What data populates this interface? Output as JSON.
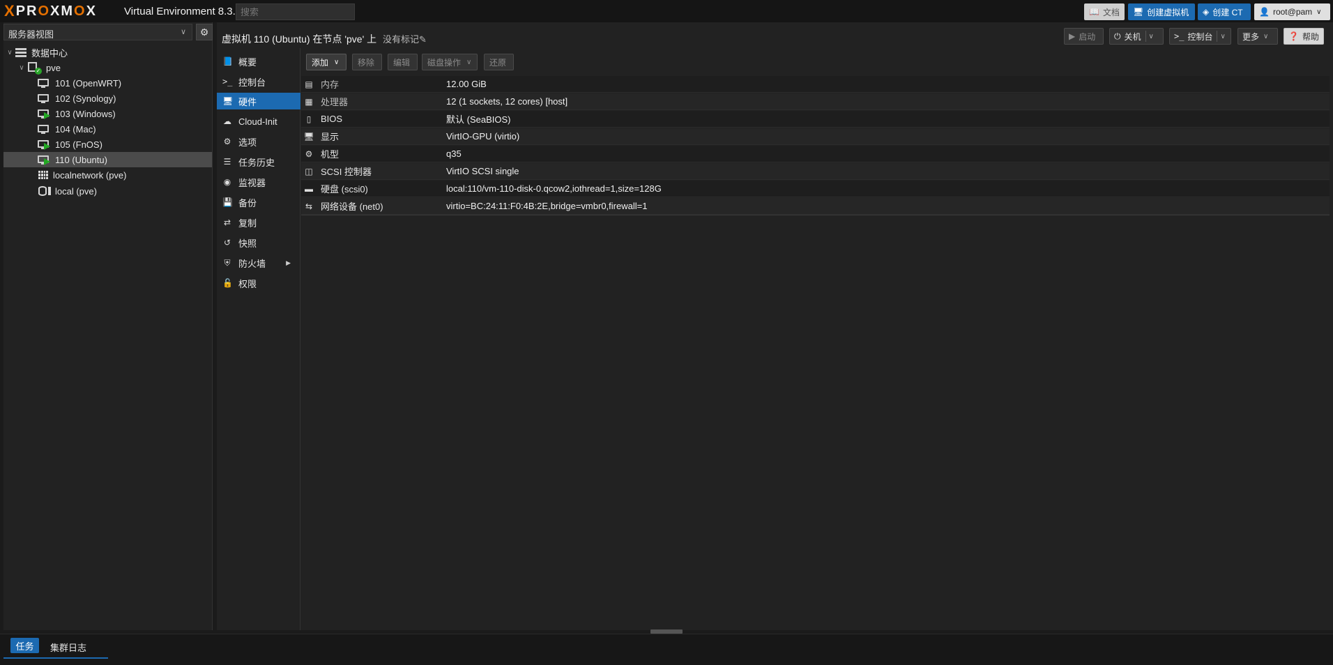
{
  "header": {
    "logo_x": "X",
    "logo_word_a": "PR",
    "logo_word_o": "O",
    "logo_word_b": "XM",
    "logo_word_o2": "O",
    "logo_word_c": "X",
    "version": "Virtual Environment 8.3.2",
    "search_placeholder": "搜索",
    "docs_label": "文档",
    "create_vm_label": "创建虚拟机",
    "create_ct_label": "创建 CT",
    "user_label": "root@pam"
  },
  "left": {
    "view_label": "服务器视图",
    "tree": [
      {
        "label": "数据中心",
        "icon": "datacenter-icon"
      },
      {
        "label": "pve",
        "icon": "node-icon"
      },
      {
        "label": "101 (OpenWRT)",
        "icon": "vm-icon",
        "running": false
      },
      {
        "label": "102 (Synology)",
        "icon": "vm-icon",
        "running": false
      },
      {
        "label": "103 (Windows)",
        "icon": "vm-icon",
        "running": true
      },
      {
        "label": "104 (Mac)",
        "icon": "vm-icon",
        "running": false
      },
      {
        "label": "105 (FnOS)",
        "icon": "vm-icon",
        "running": true
      },
      {
        "label": "110 (Ubuntu)",
        "icon": "vm-icon",
        "running": true,
        "selected": true
      },
      {
        "label": "localnetwork (pve)",
        "icon": "network-grid-icon"
      },
      {
        "label": "local (pve)",
        "icon": "storage-icon"
      }
    ]
  },
  "main": {
    "title": "虚拟机 110 (Ubuntu) 在节点 'pve' 上",
    "no_tags": "没有标记",
    "buttons": {
      "start": "启动",
      "shutdown": "关机",
      "console": "控制台",
      "more": "更多",
      "help": "帮助"
    },
    "nav": [
      {
        "label": "概要",
        "icon": "book-icon"
      },
      {
        "label": "控制台",
        "icon": "terminal-icon"
      },
      {
        "label": "硬件",
        "icon": "monitor-icon",
        "active": true
      },
      {
        "label": "Cloud-Init",
        "icon": "cloud-icon"
      },
      {
        "label": "选项",
        "icon": "gear-icon"
      },
      {
        "label": "任务历史",
        "icon": "list-icon"
      },
      {
        "label": "监视器",
        "icon": "eye-icon"
      },
      {
        "label": "备份",
        "icon": "floppy-icon"
      },
      {
        "label": "复制",
        "icon": "retweet-icon"
      },
      {
        "label": "快照",
        "icon": "history-icon"
      },
      {
        "label": "防火墙",
        "icon": "shield-icon"
      },
      {
        "label": "权限",
        "icon": "unlock-icon"
      }
    ],
    "hw_toolbar": {
      "add": "添加",
      "remove": "移除",
      "edit": "编辑",
      "disk_action": "磁盘操作",
      "revert": "还原"
    },
    "hardware": [
      {
        "name": "内存",
        "value": "12.00 GiB",
        "icon": "memory-icon"
      },
      {
        "name": "处理器",
        "value": "12 (1 sockets, 12 cores) [host]",
        "icon": "cpu-icon"
      },
      {
        "name": "BIOS",
        "value": "默认 (SeaBIOS)",
        "icon": "microchip-icon"
      },
      {
        "name": "显示",
        "value": "VirtIO-GPU (virtio)",
        "icon": "desktop-icon"
      },
      {
        "name": "机型",
        "value": "q35",
        "icon": "cogs-icon"
      },
      {
        "name": "SCSI 控制器",
        "value": "VirtIO SCSI single",
        "icon": "database-icon"
      },
      {
        "name": "硬盘 (scsi0)",
        "value": "local:110/vm-110-disk-0.qcow2,iothread=1,size=128G",
        "icon": "hdd-icon"
      },
      {
        "name": "网络设备 (net0)",
        "value": "virtio=BC:24:11:F0:4B:2E,bridge=vmbr0,firewall=1",
        "icon": "exchange-icon"
      }
    ]
  },
  "bottom": {
    "tasks_tab": "任务",
    "cluster_log_tab": "集群日志"
  }
}
